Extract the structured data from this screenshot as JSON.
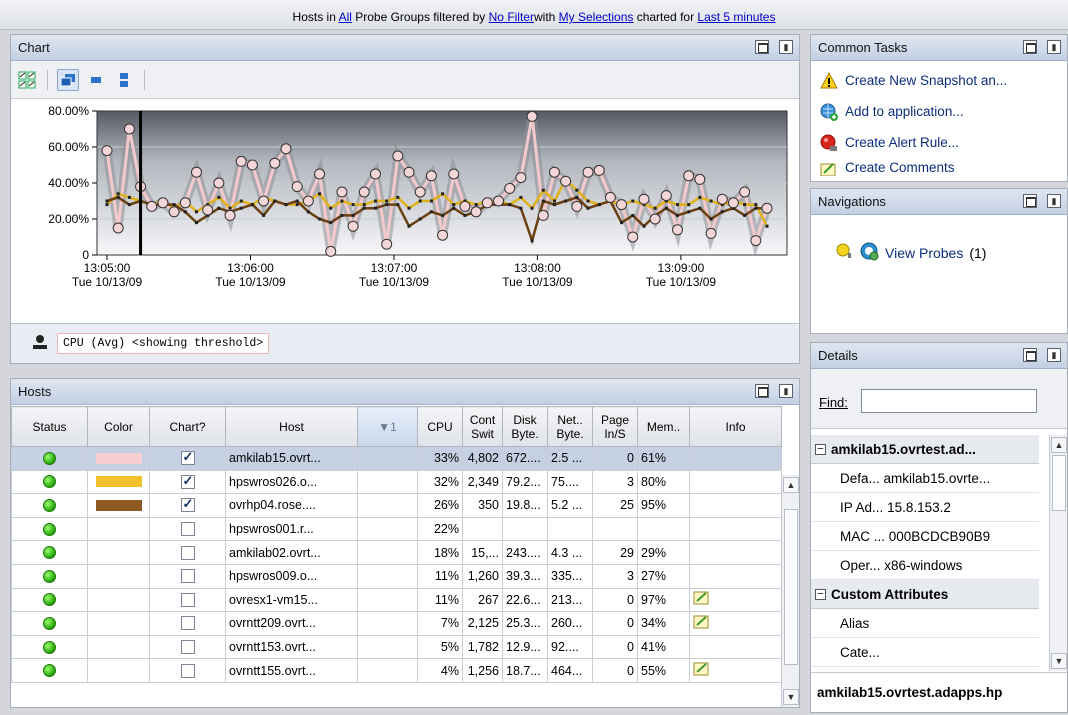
{
  "header": {
    "t1": "Hosts in ",
    "all": "All",
    "t2": " Probe Groups filtered by ",
    "filter": "No Filter",
    "t3": "with ",
    "selections": "My Selections",
    "t4": " charted for ",
    "period": "Last 5 minutes"
  },
  "chart_panel": {
    "title": "Chart",
    "legend_label": "CPU (Avg) <showing threshold>"
  },
  "chart_data": {
    "type": "line",
    "title": "",
    "ylabel": "",
    "xlabel": "",
    "y_ticks": [
      "80.00%",
      "60.00%",
      "40.00%",
      "20.00%",
      "0"
    ],
    "ylim": [
      0,
      80
    ],
    "x_ticks": [
      {
        "time": "13:05:00",
        "date": "Tue 10/13/09"
      },
      {
        "time": "13:06:00",
        "date": "Tue 10/13/09"
      },
      {
        "time": "13:07:00",
        "date": "Tue 10/13/09"
      },
      {
        "time": "13:08:00",
        "date": "Tue 10/13/09"
      },
      {
        "time": "13:09:00",
        "date": "Tue 10/13/09"
      }
    ],
    "series": [
      {
        "color": "#f4c9cc",
        "marker": "circle",
        "values": [
          58,
          15,
          70,
          38,
          27,
          29,
          24,
          29,
          46,
          25,
          40,
          22,
          52,
          50,
          30,
          51,
          59,
          38,
          30,
          45,
          2,
          35,
          16,
          35,
          45,
          6,
          55,
          46,
          35,
          44,
          11,
          45,
          27,
          24,
          29,
          30,
          37,
          43,
          77,
          22,
          46,
          41,
          27,
          46,
          47,
          32,
          28,
          10,
          31,
          20,
          33,
          14,
          44,
          42,
          12,
          31,
          29,
          35,
          8,
          26
        ]
      },
      {
        "color": "#e0b21a",
        "marker": "square",
        "values": [
          28,
          34,
          32,
          30,
          28,
          30,
          26,
          30,
          24,
          28,
          32,
          26,
          30,
          28,
          32,
          30,
          28,
          28,
          30,
          34,
          26,
          30,
          28,
          28,
          30,
          30,
          32,
          26,
          30,
          30,
          34,
          28,
          30,
          28,
          30,
          30,
          28,
          32,
          26,
          36,
          30,
          42,
          36,
          30,
          28,
          30,
          28,
          30,
          28,
          26,
          30,
          28,
          28,
          32,
          30,
          28,
          30,
          28,
          28,
          16
        ]
      },
      {
        "color": "#6a4010",
        "marker": "square",
        "values": [
          30,
          32,
          28,
          30,
          28,
          28,
          28,
          24,
          18,
          22,
          26,
          24,
          26,
          28,
          22,
          30,
          28,
          30,
          24,
          20,
          18,
          22,
          22,
          26,
          26,
          28,
          28,
          16,
          20,
          24,
          22,
          26,
          22,
          24,
          28,
          28,
          28,
          26,
          8,
          30,
          28,
          30,
          32,
          26,
          28,
          30,
          18,
          22,
          16,
          22,
          26,
          22,
          24,
          26,
          20,
          24,
          26,
          22,
          26,
          26
        ]
      }
    ],
    "cursor_index": 3,
    "grid": true
  },
  "hosts_panel": {
    "title": "Hosts",
    "columns": [
      "Status",
      "Color",
      "Chart?",
      "Host",
      "▼1",
      "CPU",
      "Cont Swit",
      "Disk Byte.",
      "Net.. Byte.",
      "Page In/S",
      "Mem..",
      "Info"
    ],
    "rows": [
      {
        "color": "#f7cfd2",
        "checked": true,
        "host": "amkilab15.ovrt...",
        "cpu": "33%",
        "cs": "4,802",
        "disk": "672....",
        "net": "2.5 ...",
        "page": "0",
        "mem": "61%",
        "info": false
      },
      {
        "color": "#f2c12e",
        "checked": true,
        "host": "hpswros026.o...",
        "cpu": "32%",
        "cs": "2,349",
        "disk": "79.2...",
        "net": "75....",
        "page": "3",
        "mem": "80%",
        "info": false
      },
      {
        "color": "#8c5a22",
        "checked": true,
        "host": "ovrhp04.rose....",
        "cpu": "26%",
        "cs": "350",
        "disk": "19.8...",
        "net": "5.2 ...",
        "page": "25",
        "mem": "95%",
        "info": false
      },
      {
        "color": "",
        "checked": false,
        "host": "hpswros001.r...",
        "cpu": "22%",
        "cs": "",
        "disk": "",
        "net": "",
        "page": "",
        "mem": "",
        "info": false
      },
      {
        "color": "",
        "checked": false,
        "host": "amkilab02.ovrt...",
        "cpu": "18%",
        "cs": "15,...",
        "disk": "243....",
        "net": "4.3 ...",
        "page": "29",
        "mem": "29%",
        "info": false
      },
      {
        "color": "",
        "checked": false,
        "host": "hpswros009.o...",
        "cpu": "11%",
        "cs": "1,260",
        "disk": "39.3...",
        "net": "335...",
        "page": "3",
        "mem": "27%",
        "info": false
      },
      {
        "color": "",
        "checked": false,
        "host": "ovresx1-vm15...",
        "cpu": "11%",
        "cs": "267",
        "disk": "22.6...",
        "net": "213...",
        "page": "0",
        "mem": "97%",
        "info": true
      },
      {
        "color": "",
        "checked": false,
        "host": "ovrntt209.ovrt...",
        "cpu": "7%",
        "cs": "2,125",
        "disk": "25.3...",
        "net": "260...",
        "page": "0",
        "mem": "34%",
        "info": true
      },
      {
        "color": "",
        "checked": false,
        "host": "ovrntt153.ovrt...",
        "cpu": "5%",
        "cs": "1,782",
        "disk": "12.9...",
        "net": "92....",
        "page": "0",
        "mem": "41%",
        "info": false
      },
      {
        "color": "",
        "checked": false,
        "host": "ovrntt155.ovrt...",
        "cpu": "4%",
        "cs": "1,256",
        "disk": "18.7...",
        "net": "464...",
        "page": "0",
        "mem": "55%",
        "info": true
      }
    ]
  },
  "tasks_panel": {
    "title": "Common Tasks",
    "items": [
      {
        "label": "Create New Snapshot an...",
        "icon": "warning-icon"
      },
      {
        "label": "Add to application...",
        "icon": "globe-add-icon"
      },
      {
        "label": "Create Alert Rule...",
        "icon": "alert-rule-icon"
      },
      {
        "label": "Create Comments",
        "icon": "comment-icon"
      }
    ]
  },
  "nav_panel": {
    "title": "Navigations",
    "link": "View Probes",
    "count": "(1)"
  },
  "details_panel": {
    "title": "Details",
    "find_label": "Find:",
    "find_value": "",
    "section1": "amkilab15.ovrtest.ad...",
    "rows1": [
      {
        "k": "Defa...",
        "v": "amkilab15.ovrte..."
      },
      {
        "k": "IP Ad...",
        "v": "15.8.153.2"
      },
      {
        "k": "MAC ...",
        "v": "000BCDCB90B9"
      },
      {
        "k": "Oper...",
        "v": "x86-windows"
      }
    ],
    "section2": "Custom Attributes",
    "rows2": [
      {
        "k": "Alias",
        "v": ""
      },
      {
        "k": "Cate...",
        "v": ""
      }
    ],
    "footer": "amkilab15.ovrtest.adapps.hp"
  }
}
